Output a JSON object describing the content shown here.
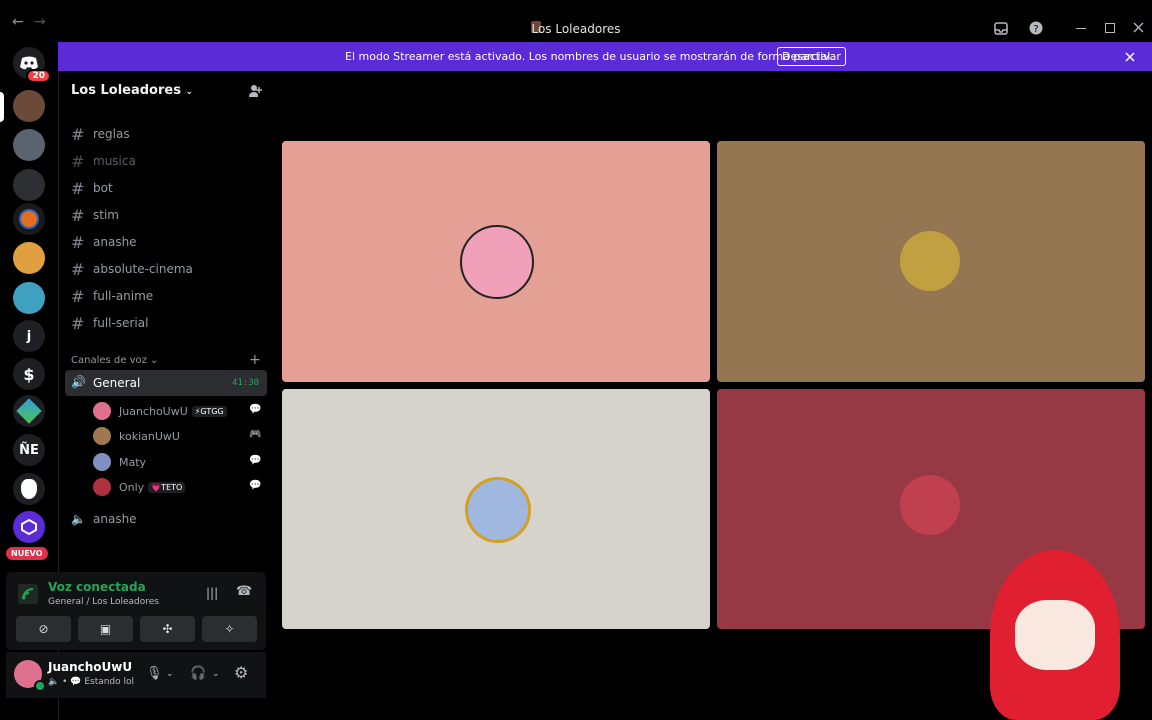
{
  "window": {
    "title": "Los Loleadores",
    "back_icon": "←",
    "forward_icon": "→"
  },
  "banner": {
    "text": "El modo Streamer está activado. Los nombres de usuario se mostrarán de forma parcial.",
    "button_label": "Desactivar",
    "color": "#5b2bd8"
  },
  "rail": {
    "home_badge": "20",
    "items": [
      "j",
      "ÑE"
    ],
    "new_label": "NUEVO"
  },
  "server": {
    "name": "Los Loleadores"
  },
  "text_channels": [
    "reglas",
    "musica",
    "bot",
    "stim",
    "anashe",
    "absolute-cinema",
    "full-anime",
    "full-serial"
  ],
  "voice_section": {
    "title": "Canales de voz",
    "active_channel": "General",
    "timer": "41:30",
    "members": [
      {
        "name": "JuanchoUwU",
        "tag": "⚡GTGG"
      },
      {
        "name": "kokianUwU",
        "tag": ""
      },
      {
        "name": "Maty",
        "tag": ""
      },
      {
        "name": "Only",
        "tag": "💗TETO"
      }
    ],
    "other_channel": "anashe"
  },
  "voice_panel": {
    "status": "Voz conectada",
    "location": "General / Los Loleadores"
  },
  "user_panel": {
    "name": "JuanchoUwU",
    "status": "Estando lol"
  },
  "tile_colors": [
    "#e4a094",
    "#957653",
    "#d6d2cc",
    "#973845"
  ]
}
